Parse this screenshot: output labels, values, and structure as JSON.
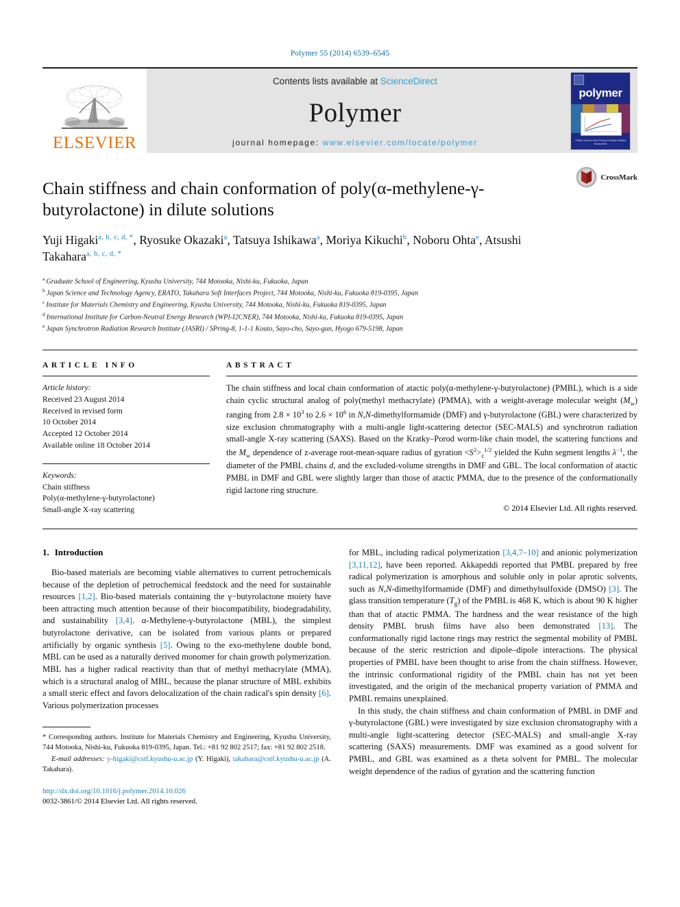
{
  "running_head": "Polymer 55 (2014) 6539–6545",
  "banner": {
    "publisher_wordmark": "ELSEVIER",
    "contents_prefix": "Contents lists available at ",
    "contents_link": "ScienceDirect",
    "journal_title": "Polymer",
    "homepage_prefix": "journal homepage: ",
    "homepage_url": "www.elsevier.com/locate/polymer",
    "cover_title": "polymer",
    "cover_footer": "Official Journal of the Polymer Division\nWilliam Brostow/Ed",
    "accent_link_color": "#2b9fd4",
    "elsevier_orange": "#ec7000",
    "cover_blue": "#1c2a86"
  },
  "article": {
    "crossmark_label": "CrossMark",
    "title": "Chain stiffness and chain conformation of poly(α-methylene-γ-butyrolactone) in dilute solutions",
    "authors": [
      {
        "name": "Yuji Higaki",
        "marks": "a, b, c, d, *",
        "sep": ", "
      },
      {
        "name": "Ryosuke Okazaki",
        "marks": "a",
        "sep": ", "
      },
      {
        "name": "Tatsuya Ishikawa",
        "marks": "a",
        "sep": ", "
      },
      {
        "name": "Moriya Kikuchi",
        "marks": "b",
        "sep": ", "
      },
      {
        "name": "Noboru Ohta",
        "marks": "e",
        "sep": ", "
      },
      {
        "name": "Atsushi Takahara",
        "marks": "a, b, c, d, *",
        "sep": ""
      }
    ],
    "affiliations": [
      {
        "mark": "a",
        "text": "Graduate School of Engineering, Kyushu University, 744 Motooka, Nishi-ku, Fukuoka, Japan"
      },
      {
        "mark": "b",
        "text": "Japan Science and Technology Agency, ERATO, Takahara Soft Interfaces Project, 744 Motooka, Nishi-ku, Fukuoka 819-0395, Japan"
      },
      {
        "mark": "c",
        "text": "Institute for Materials Chemistry and Engineering, Kyushu University, 744 Motooka, Nishi-ku, Fukuoka 819-0395, Japan"
      },
      {
        "mark": "d",
        "text": "International Institute for Carbon-Neutral Energy Research (WPI-I2CNER), 744 Motooka, Nishi-ku, Fukuoka 819-0395, Japan"
      },
      {
        "mark": "e",
        "text": "Japan Synchrotron Radiation Research Institute (JASRI) / SPring-8, 1-1-1 Kouto, Sayo-cho, Sayo-gun, Hyogo 679-5198, Japan"
      }
    ]
  },
  "article_info": {
    "heading": "ARTICLE INFO",
    "history_label": "Article history:",
    "history": [
      "Received 23 August 2014",
      "Received in revised form",
      "10 October 2014",
      "Accepted 12 October 2014",
      "Available online 18 October 2014"
    ],
    "keywords_label": "Keywords:",
    "keywords": [
      "Chain stiffness",
      "Poly(α-methylene-γ-butyrolactone)",
      "Small-angle X-ray scattering"
    ]
  },
  "abstract": {
    "heading": "ABSTRACT",
    "copyright": "© 2014 Elsevier Ltd. All rights reserved."
  },
  "introduction": {
    "heading_num": "1.",
    "heading_text": "Introduction"
  },
  "footnote": {
    "corresponding": "Corresponding authors. Institute for Materials Chemistry and Engineering, Kyushu University, 744 Motooka, Nishi-ku, Fukuoka 819-0395, Japan. Tel.: +81 92 802 2517; fax: +81 92 802 2518.",
    "email_label": "E-mail addresses:",
    "email1": "y-higaki@cstf.kyushu-u.ac.jp",
    "email1_owner": "(Y. Higaki)",
    "email2": "takahara@cstf.kyushu-u.ac.jp",
    "email2_owner": "(A. Takahara)."
  },
  "doi": {
    "url": "http://dx.doi.org/10.1016/j.polymer.2014.10.026",
    "issn_line": "0032-3861/© 2014 Elsevier Ltd. All rights reserved."
  }
}
